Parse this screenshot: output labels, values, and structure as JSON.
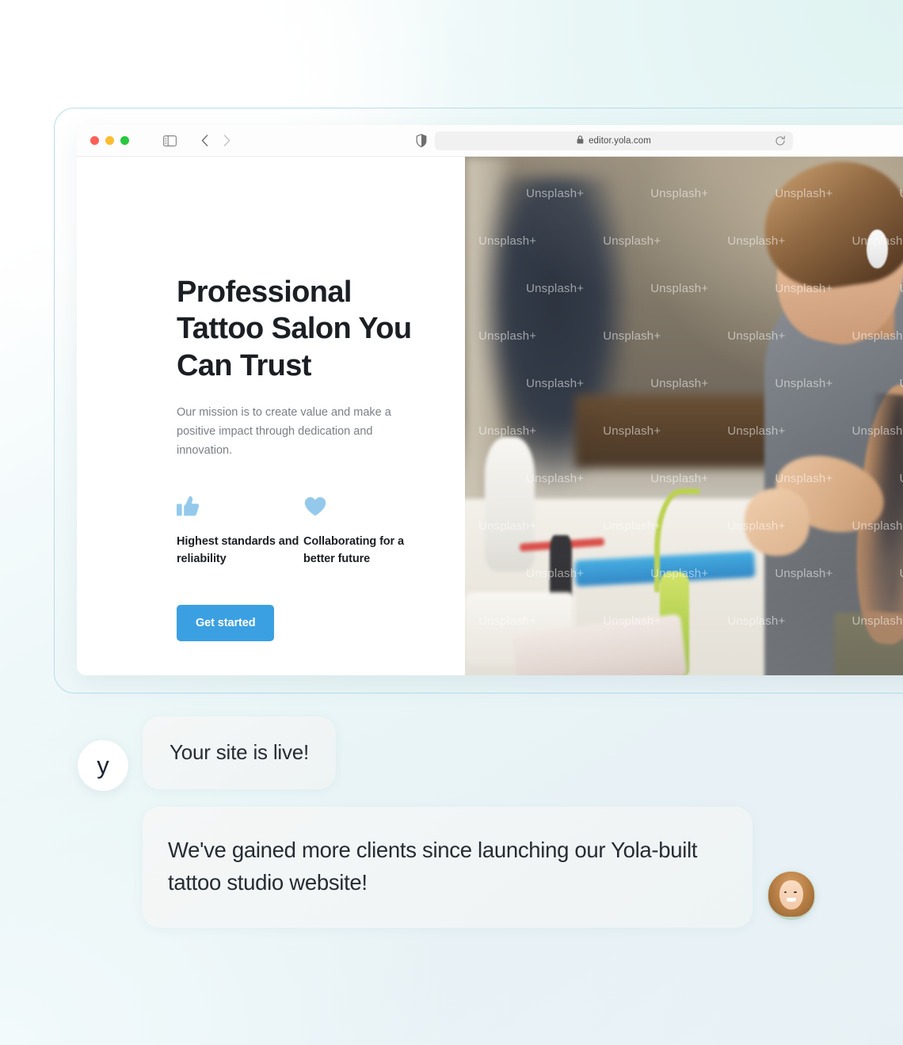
{
  "browser": {
    "traffic_lights": [
      "close",
      "minimize",
      "zoom"
    ],
    "sidebar_icon": "sidebar-icon",
    "back_icon": "chevron-left-icon",
    "forward_icon": "chevron-right-icon",
    "shield_icon": "shield-icon",
    "lock_icon": "lock-icon",
    "url": "editor.yola.com",
    "reload_icon": "reload-icon"
  },
  "site": {
    "headline": "Professional Tattoo Salon You Can Trust",
    "subcopy": "Our mission is to create value and make a positive impact through dedication and innovation.",
    "features": [
      {
        "icon": "thumbs-up-icon",
        "label": "Highest standards and reliability"
      },
      {
        "icon": "heart-icon",
        "label": "Collaborating for a better future"
      }
    ],
    "cta_label": "Get started",
    "hero_image_alt": "tattoo artist preparing equipment in studio",
    "hero_watermark": "Unsplash+"
  },
  "chat": [
    {
      "avatar": "yola-logo-avatar",
      "avatar_letter": "y",
      "message": "Your site is live!"
    },
    {
      "avatar": "customer-photo-avatar",
      "message": "We've gained more clients since launching our Yola-built tattoo studio website!"
    }
  ],
  "colors": {
    "accent_blue": "#3ba0e2",
    "icon_blue": "#94c9ec",
    "headline": "#1b1f23",
    "body_text": "#7b7f84",
    "bubble_bg": "#f1f5f6",
    "page_bg_mint": "#e8f6f6",
    "page_bg_blue": "#e8f2f6"
  }
}
